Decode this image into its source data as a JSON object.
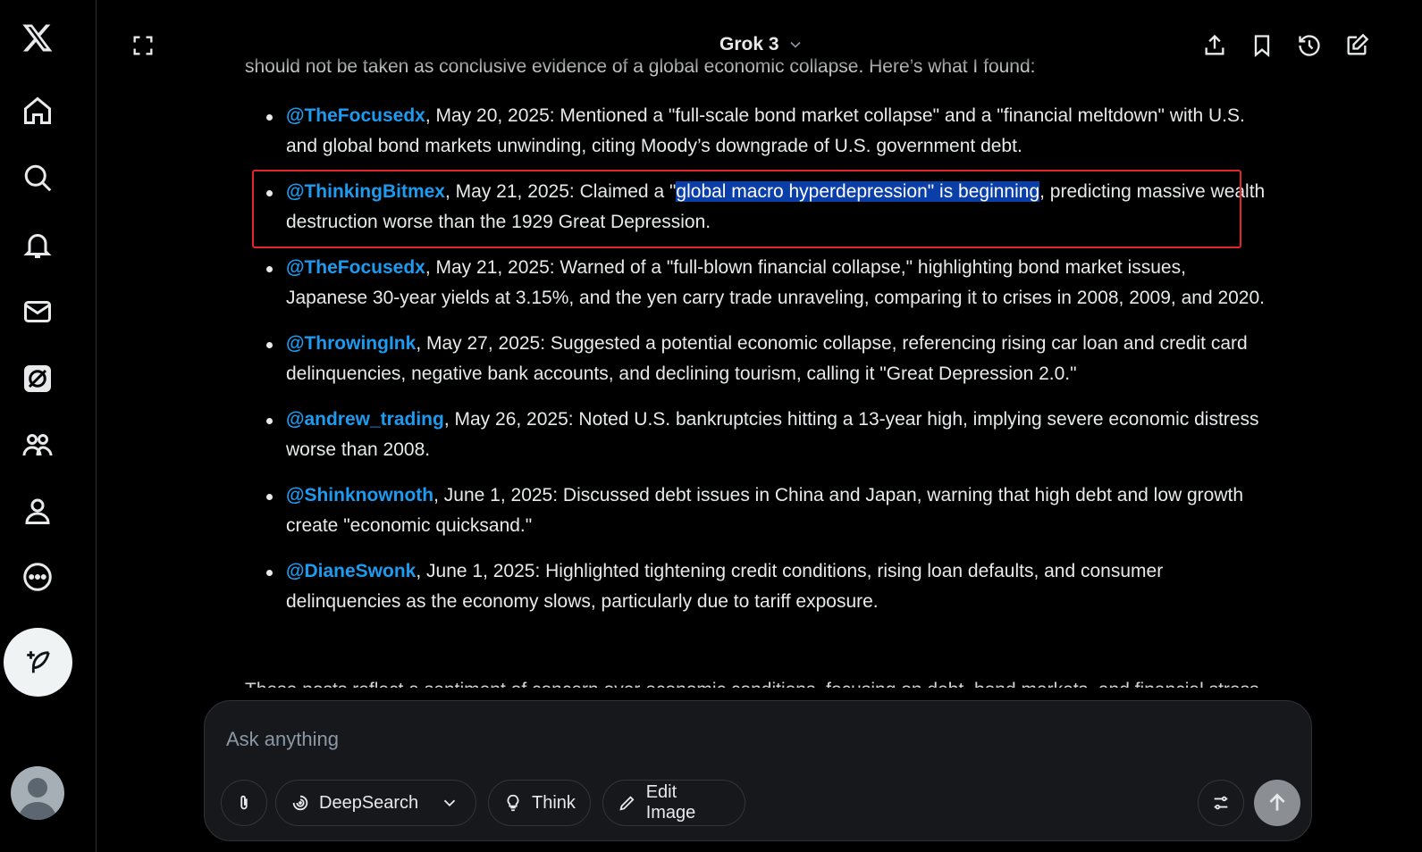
{
  "app": {
    "logo": "x-logo"
  },
  "nav": {
    "items": [
      {
        "name": "home",
        "icon": "home-icon"
      },
      {
        "name": "explore",
        "icon": "search-icon"
      },
      {
        "name": "notifications",
        "icon": "bell-icon"
      },
      {
        "name": "messages",
        "icon": "mail-icon"
      },
      {
        "name": "grok",
        "icon": "grok-icon"
      },
      {
        "name": "communities",
        "icon": "people-icon"
      },
      {
        "name": "profile",
        "icon": "person-icon"
      },
      {
        "name": "more",
        "icon": "more-icon"
      }
    ],
    "compose_icon": "feather-plus-icon"
  },
  "header": {
    "model": "Grok 3"
  },
  "conversation": {
    "intro": "should not be taken as conclusive evidence of a global economic collapse. Here’s what I found:",
    "posts": [
      {
        "handle": "@TheFocusedx",
        "text": ", May 20, 2025: Mentioned a \"full-scale bond market collapse\" and a \"financial meltdown\" with U.S. and global bond markets unwinding, citing Moody’s downgrade of U.S. government debt."
      },
      {
        "handle": "@ThinkingBitmex",
        "text_before": ", May 21, 2025: Claimed a \"",
        "highlight": "global macro hyperdepression\" is beginning",
        "text_after": ", predicting massive wealth destruction worse than the 1929 Great Depression."
      },
      {
        "handle": "@TheFocusedx",
        "text": ", May 21, 2025: Warned of a \"full-blown financial collapse,\" highlighting bond market issues, Japanese 30-year yields at 3.15%, and the yen carry trade unraveling, comparing it to crises in 2008, 2009, and 2020."
      },
      {
        "handle": "@ThrowingInk",
        "text": ", May 27, 2025: Suggested a potential economic collapse, referencing rising car loan and credit card delinquencies, negative bank accounts, and declining tourism, calling it \"Great Depression 2.0.\""
      },
      {
        "handle": "@andrew_trading",
        "text": ", May 26, 2025: Noted U.S. bankruptcies hitting a 13-year high, implying severe economic distress worse than 2008."
      },
      {
        "handle": "@Shinknownoth",
        "text": ", June 1, 2025: Discussed debt issues in China and Japan, warning that high debt and low growth create \"economic quicksand.\""
      },
      {
        "handle": "@DianeSwonk",
        "text": ", June 1, 2025: Highlighted tightening credit conditions, rising loan defaults, and consumer delinquencies as the economy slows, particularly due to tariff exposure."
      }
    ],
    "cutoff_text": "These posts reflect a sentiment of concern over economic conditions, focusing on debt, bond markets, and financial stress"
  },
  "composer": {
    "placeholder": "Ask anything",
    "deepsearch_label": "DeepSearch",
    "think_label": "Think",
    "edit_image_label": "Edit Image"
  },
  "colors": {
    "accent": "#1d9bf0",
    "highlight": "#0a3ea8",
    "annotation": "#e0262b"
  }
}
